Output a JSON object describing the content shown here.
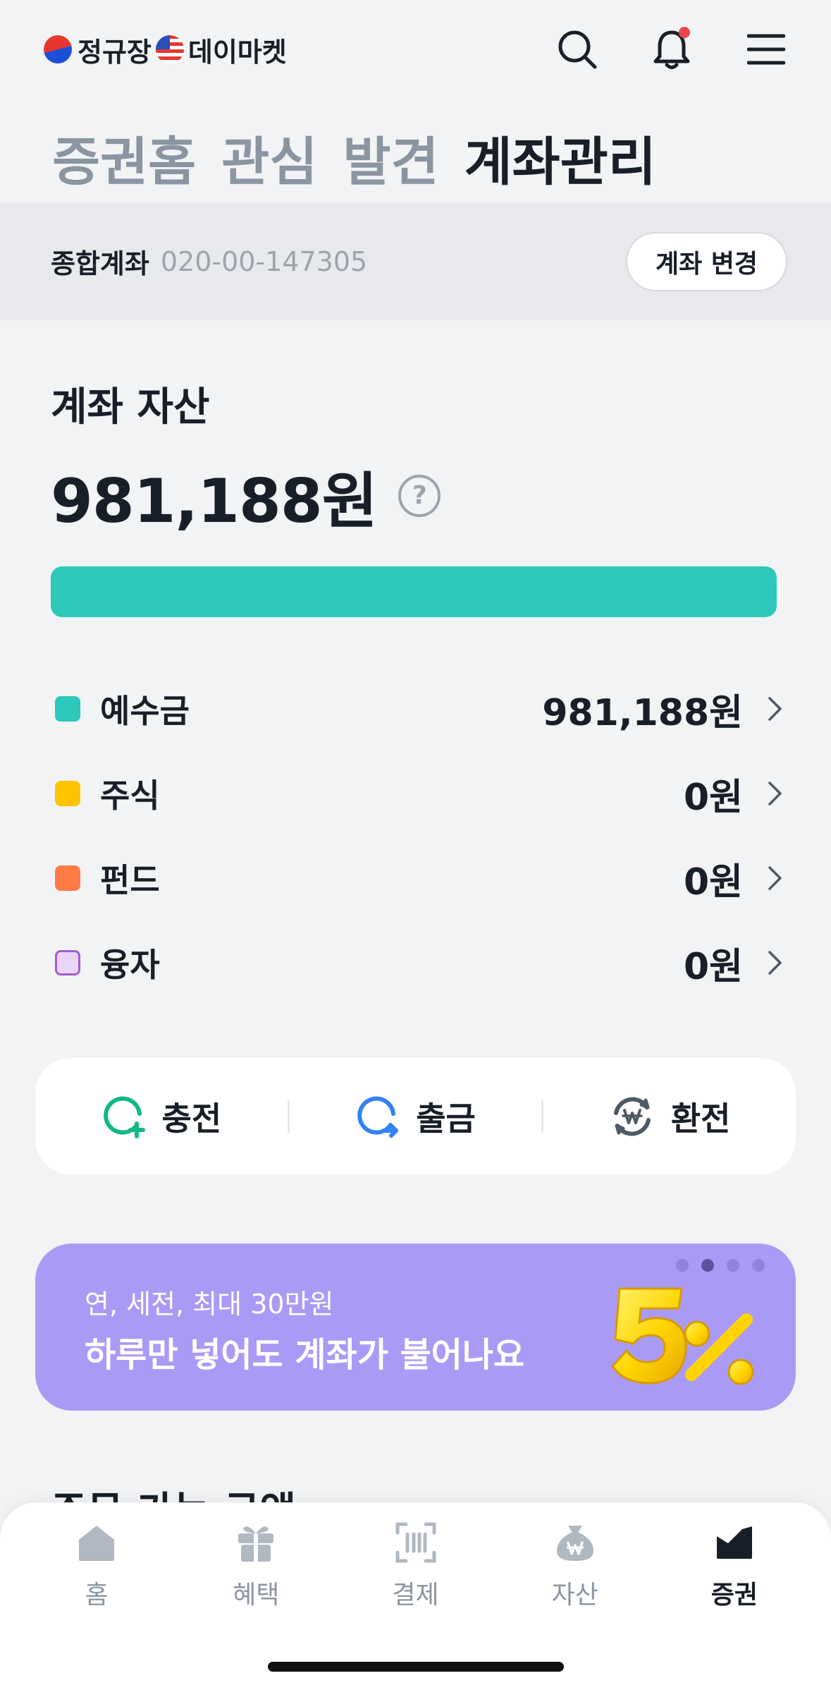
{
  "header": {
    "brand_kr": "정규장",
    "brand_us": "데이마켓"
  },
  "tabs": [
    {
      "label": "증권홈"
    },
    {
      "label": "관심"
    },
    {
      "label": "발견"
    },
    {
      "label": "계좌관리"
    }
  ],
  "account": {
    "label": "종합계좌",
    "number": "020-00-147305",
    "change_label": "계좌 변경"
  },
  "assets": {
    "title": "계좌 자산",
    "total": "981,188원",
    "help_glyph": "?",
    "bar_fill_fraction": 1.0,
    "bar_color": "#2cc8bc",
    "items": [
      {
        "label": "예수금",
        "value": "981,188원",
        "color": "#2cc8bc"
      },
      {
        "label": "주식",
        "value": "0원",
        "color": "#ffc300"
      },
      {
        "label": "펀드",
        "value": "0원",
        "color": "#ff7a45"
      },
      {
        "label": "융자",
        "value": "0원",
        "color": "#e9d5f7"
      }
    ]
  },
  "actions": [
    {
      "label": "충전",
      "icon": "charge-icon"
    },
    {
      "label": "출금",
      "icon": "withdraw-icon"
    },
    {
      "label": "환전",
      "icon": "exchange-icon"
    }
  ],
  "banner": {
    "subtitle": "연, 세전, 최대 30만원",
    "title": "하루만 넣어도 계좌가 불어나요",
    "page_count": 4,
    "active_page": 2,
    "bg_color": "#a99bf5"
  },
  "section_title": "주문 가능 금액",
  "bottom_nav": [
    {
      "label": "홈",
      "icon": "home-icon"
    },
    {
      "label": "혜택",
      "icon": "gift-icon"
    },
    {
      "label": "결제",
      "icon": "barcode-icon"
    },
    {
      "label": "자산",
      "icon": "money-bag-icon"
    },
    {
      "label": "증권",
      "icon": "stock-chart-icon",
      "active": true
    }
  ]
}
